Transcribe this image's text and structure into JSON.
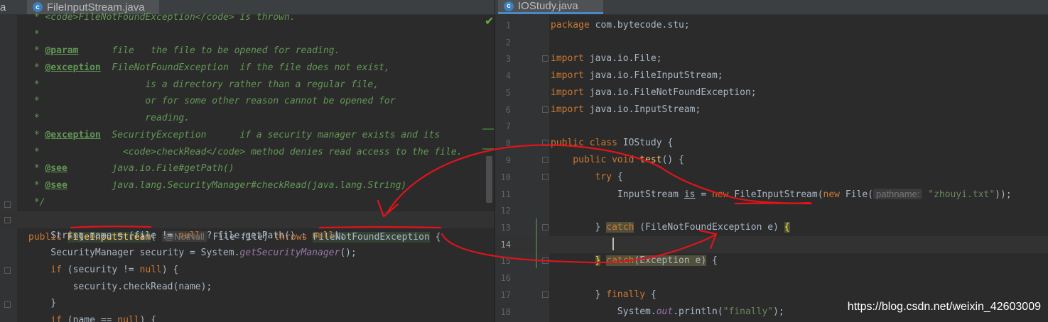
{
  "tabs": {
    "left_clip": "a",
    "left_file": "FileInputStream.java",
    "left_icon": "c",
    "right_file": "IOStudy.java",
    "right_icon": "c"
  },
  "left_code": {
    "l1_a": " * ",
    "l1_b": "<code>FileNotFoundException</code> is thrown.",
    "l2": " *",
    "l3_a": " * ",
    "l3_tag": "@param",
    "l3_b": "      file   the file to be opened for reading.",
    "l4_a": " * ",
    "l4_tag": "@exception",
    "l4_b": "  FileNotFoundException  if the file does not exist,",
    "l5": " *                   is a directory rather than a regular file,",
    "l6": " *                   or for some other reason cannot be opened for",
    "l7": " *                   reading.",
    "l8_a": " * ",
    "l8_tag": "@exception",
    "l8_b": "  SecurityException      if a security manager exists and its",
    "l9": " *               <code>checkRead</code> method denies read access to the file.",
    "l10_a": " * ",
    "l10_tag": "@see",
    "l10_b": "        java.io.File#getPath()",
    "l11_a": " * ",
    "l11_tag": "@see",
    "l11_b": "        java.lang.SecurityManager#checkRead(java.lang.String)",
    "l12": " */",
    "l13_kw": "public",
    "l13_name": "FileInputStream",
    "l13_paren": "(",
    "l13_hint": "@NotNull",
    "l13_b": " File file) ",
    "l13_kw2": "throws",
    "l13_exc": "FileNotFoundException",
    "l13_end": " {",
    "l14": "    String name = (file != ",
    "l14_null": "null",
    "l14_b": " ? file.getPath() : ",
    "l14_null2": "null",
    "l14_end": ");",
    "l15": "    SecurityManager security = System.",
    "l15_m": "getSecurityManager",
    "l15_end": "();",
    "l16_kw": "    if",
    "l16_b": " (security != ",
    "l16_null": "null",
    "l16_end": ") {",
    "l17": "        security.checkRead(name);",
    "l18": "    }",
    "l19_kw": "    if",
    "l19_b": " (name == ",
    "l19_null": "null",
    "l19_end": ") {"
  },
  "right_code": {
    "lines": [
      "1",
      "2",
      "3",
      "4",
      "5",
      "6",
      "7",
      "8",
      "9",
      "10",
      "11",
      "12",
      "13",
      "14",
      "15",
      "16",
      "17",
      "18"
    ],
    "r1_kw": "package",
    "r1_b": " com.bytecode.stu;",
    "r3_kw": "import",
    "r3_b": " java.io.File;",
    "r4_kw": "import",
    "r4_b": " java.io.FileInputStream;",
    "r5_kw": "import",
    "r5_b": " java.io.FileNotFoundException;",
    "r6_kw": "import",
    "r6_b": " java.io.InputStream;",
    "r8_kw": "public class",
    "r8_b": " IOStudy {",
    "r9_kw": "    public void",
    "r9_fn": " test",
    "r9_b": "() {",
    "r10_kw": "        try",
    "r10_b": " {",
    "r11_a": "            InputStream ",
    "r11_var": "is",
    "r11_b": " = ",
    "r11_kw": "new",
    "r11_cls": " FileInputStream(",
    "r11_kw2": "new",
    "r11_c": " File(",
    "r11_hint": "pathname:",
    "r11_str": "\"zhouyi.txt\"",
    "r11_end": "));",
    "r13_a": "        } ",
    "r13_kw": "catch",
    "r13_b": " (FileNotFoundException e) ",
    "r13_brace": "{",
    "r15_a": "        ",
    "r15_brace": "}",
    "r15_sp": " ",
    "r15_kw": "catch",
    "r15_b": "(Exception e)",
    "r15_end": " {",
    "r17_a": "        } ",
    "r17_kw": "finally",
    "r17_b": " {",
    "r18_a": "            System.",
    "r18_stat": "out",
    "r18_b": ".println(",
    "r18_str": "\"finally\"",
    "r18_end": ");"
  },
  "watermark": "https://blog.csdn.net/weixin_42603009",
  "icons": {
    "tab": "java-class-icon",
    "status": "check-icon"
  },
  "colors": {
    "keyword": "#cc7832",
    "doc": "#629755",
    "string": "#6a8759",
    "ink": "#e0141a"
  }
}
